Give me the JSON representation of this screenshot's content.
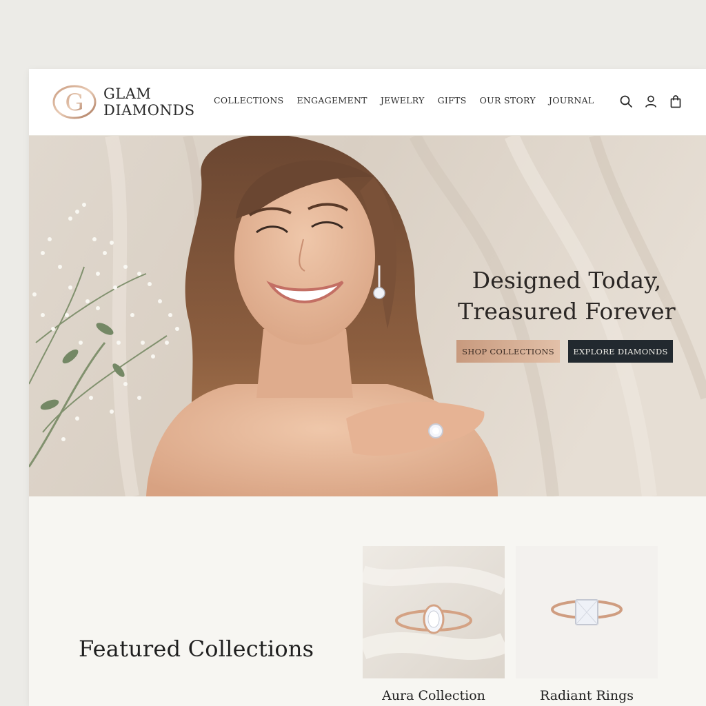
{
  "brand": {
    "line1": "GLAM",
    "line2": "DIAMONDS",
    "monogram": "G",
    "accent": "#b8876a"
  },
  "nav": {
    "items": [
      "COLLECTIONS",
      "ENGAGEMENT",
      "JEWELRY",
      "GIFTS",
      "OUR STORY",
      "JOURNAL"
    ]
  },
  "header_icons": [
    "search-icon",
    "account-icon",
    "shopping-bag-icon"
  ],
  "hero": {
    "title_line1": "Designed Today,",
    "title_line2": "Treasured Forever",
    "primary_button": "SHOP COLLECTIONS",
    "secondary_button": "EXPLORE DIAMONDS"
  },
  "featured": {
    "title": "Featured Collections",
    "cards": [
      {
        "label": "Aura Collection"
      },
      {
        "label": "Radiant Rings"
      }
    ]
  },
  "colors": {
    "rose_gold": "#d4a98c",
    "dark_button": "#22292f",
    "page_bg": "#f7f6f2"
  }
}
